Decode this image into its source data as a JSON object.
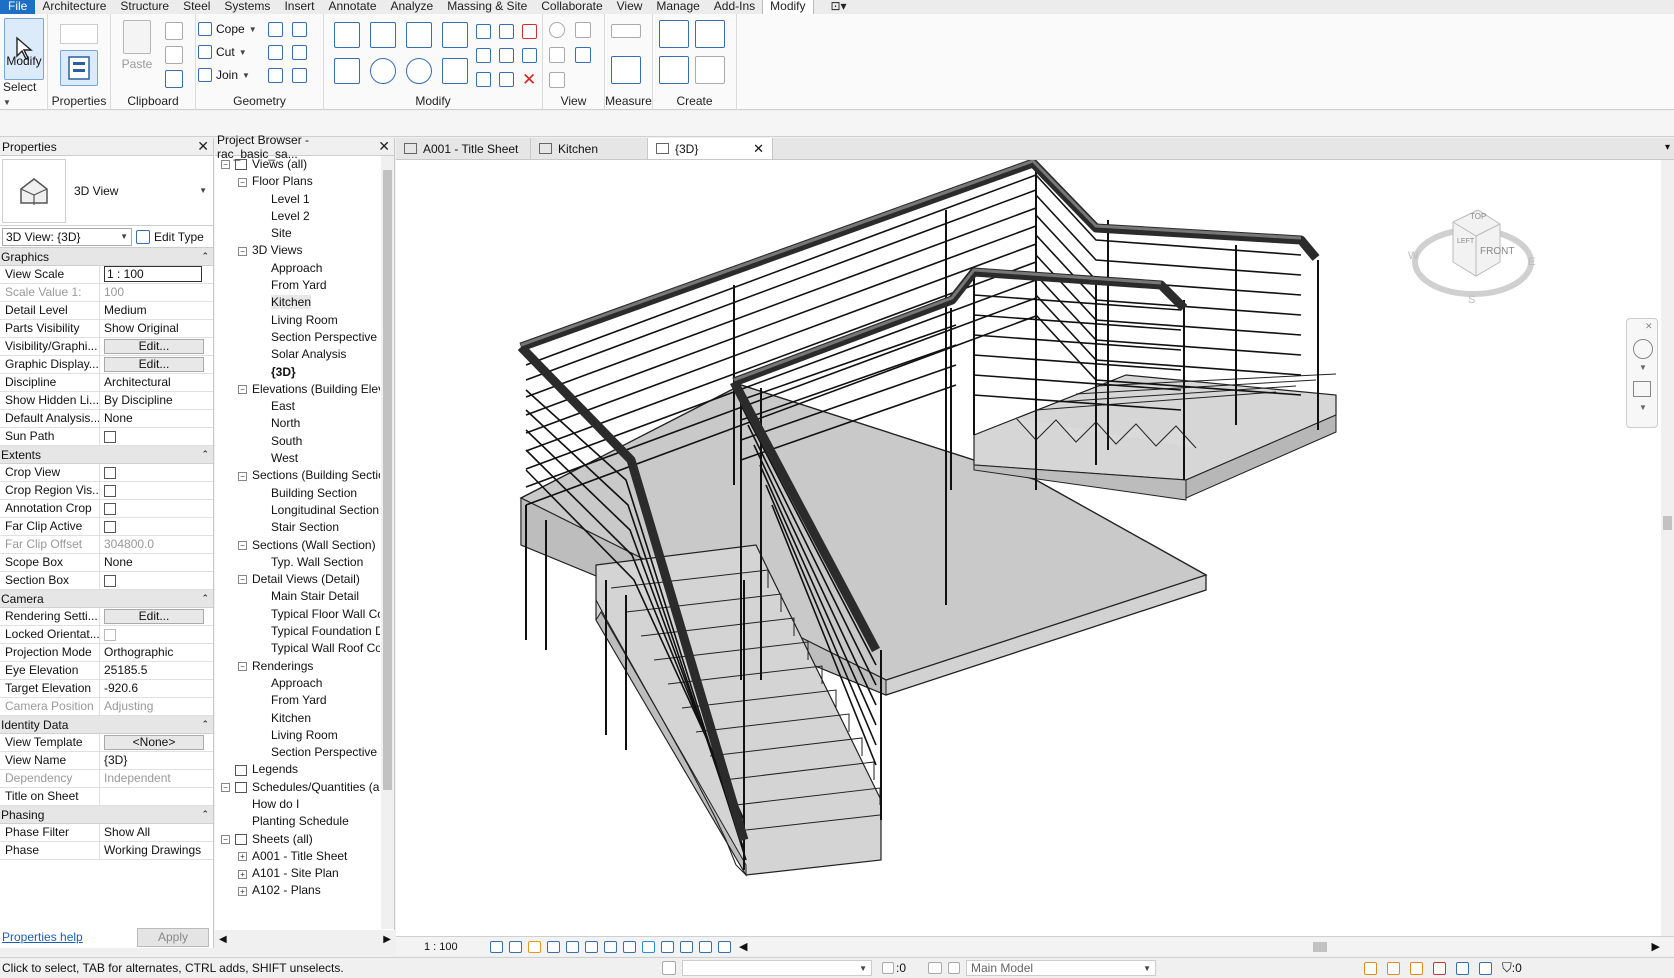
{
  "menu": {
    "file": "File",
    "tabs": [
      "Architecture",
      "Structure",
      "Steel",
      "Systems",
      "Insert",
      "Annotate",
      "Analyze",
      "Massing & Site",
      "Collaborate",
      "View",
      "Manage",
      "Add-Ins",
      "Modify"
    ],
    "active": "Modify"
  },
  "ribbon": {
    "select": {
      "modify_label": "Modify",
      "panel": "Select"
    },
    "properties": {
      "panel": "Properties"
    },
    "clipboard": {
      "paste_label": "Paste",
      "panel": "Clipboard"
    },
    "geometry": {
      "cope_label": "Cope",
      "cut_label": "Cut",
      "join_label": "Join",
      "panel": "Geometry"
    },
    "modify": {
      "panel": "Modify"
    },
    "view": {
      "panel": "View"
    },
    "measure": {
      "panel": "Measure"
    },
    "create": {
      "panel": "Create"
    }
  },
  "properties": {
    "title": "Properties",
    "type_name": "3D View",
    "view_selector": "3D View: {3D}",
    "edit_type": "Edit Type",
    "sections": [
      {
        "name": "Graphics",
        "rows": [
          {
            "k": "View Scale",
            "v": "1 : 100",
            "t": "input"
          },
          {
            "k": "Scale Value    1:",
            "v": "100",
            "t": "dis"
          },
          {
            "k": "Detail Level",
            "v": "Medium"
          },
          {
            "k": "Parts Visibility",
            "v": "Show Original"
          },
          {
            "k": "Visibility/Graphi...",
            "v": "Edit...",
            "t": "btn"
          },
          {
            "k": "Graphic Display...",
            "v": "Edit...",
            "t": "btn"
          },
          {
            "k": "Discipline",
            "v": "Architectural"
          },
          {
            "k": "Show Hidden Li...",
            "v": "By Discipline"
          },
          {
            "k": "Default Analysis...",
            "v": "None"
          },
          {
            "k": "Sun Path",
            "v": "",
            "t": "chk"
          }
        ]
      },
      {
        "name": "Extents",
        "rows": [
          {
            "k": "Crop View",
            "v": "",
            "t": "chk"
          },
          {
            "k": "Crop Region Vis...",
            "v": "",
            "t": "chk"
          },
          {
            "k": "Annotation Crop",
            "v": "",
            "t": "chk"
          },
          {
            "k": "Far Clip Active",
            "v": "",
            "t": "chk"
          },
          {
            "k": "Far Clip Offset",
            "v": "304800.0",
            "t": "dis"
          },
          {
            "k": "Scope Box",
            "v": "None"
          },
          {
            "k": "Section Box",
            "v": "",
            "t": "chk"
          }
        ]
      },
      {
        "name": "Camera",
        "rows": [
          {
            "k": "Rendering Setti...",
            "v": "Edit...",
            "t": "btn"
          },
          {
            "k": "Locked Orientat...",
            "v": "",
            "t": "chkdis"
          },
          {
            "k": "Projection Mode",
            "v": "Orthographic"
          },
          {
            "k": "Eye Elevation",
            "v": "25185.5"
          },
          {
            "k": "Target Elevation",
            "v": "-920.6"
          },
          {
            "k": "Camera Position",
            "v": "Adjusting",
            "t": "dis"
          }
        ]
      },
      {
        "name": "Identity Data",
        "rows": [
          {
            "k": "View Template",
            "v": "<None>",
            "t": "btn"
          },
          {
            "k": "View Name",
            "v": "{3D}"
          },
          {
            "k": "Dependency",
            "v": "Independent",
            "t": "dis"
          },
          {
            "k": "Title on Sheet",
            "v": ""
          }
        ]
      },
      {
        "name": "Phasing",
        "rows": [
          {
            "k": "Phase Filter",
            "v": "Show All"
          },
          {
            "k": "Phase",
            "v": "Working Drawings"
          }
        ]
      }
    ],
    "help_link": "Properties help",
    "apply": "Apply"
  },
  "browser": {
    "title": "Project Browser - rac_basic_sa...",
    "nodes": [
      {
        "l": 0,
        "t": "Views (all)",
        "tog": "-",
        "icon": true
      },
      {
        "l": 1,
        "t": "Floor Plans",
        "tog": "-"
      },
      {
        "l": 2,
        "t": "Level 1"
      },
      {
        "l": 2,
        "t": "Level 2"
      },
      {
        "l": 2,
        "t": "Site"
      },
      {
        "l": 1,
        "t": "3D Views",
        "tog": "-"
      },
      {
        "l": 2,
        "t": "Approach"
      },
      {
        "l": 2,
        "t": "From Yard"
      },
      {
        "l": 2,
        "t": "Kitchen",
        "sel": true
      },
      {
        "l": 2,
        "t": "Living Room"
      },
      {
        "l": 2,
        "t": "Section Perspective"
      },
      {
        "l": 2,
        "t": "Solar Analysis"
      },
      {
        "l": 2,
        "t": "{3D}",
        "bold": true
      },
      {
        "l": 1,
        "t": "Elevations (Building Eleva",
        "tog": "-"
      },
      {
        "l": 2,
        "t": "East"
      },
      {
        "l": 2,
        "t": "North"
      },
      {
        "l": 2,
        "t": "South"
      },
      {
        "l": 2,
        "t": "West"
      },
      {
        "l": 1,
        "t": "Sections (Building Sectio",
        "tog": "-"
      },
      {
        "l": 2,
        "t": "Building Section"
      },
      {
        "l": 2,
        "t": "Longitudinal Section"
      },
      {
        "l": 2,
        "t": "Stair Section"
      },
      {
        "l": 1,
        "t": "Sections (Wall Section)",
        "tog": "-"
      },
      {
        "l": 2,
        "t": "Typ. Wall Section"
      },
      {
        "l": 1,
        "t": "Detail Views (Detail)",
        "tog": "-"
      },
      {
        "l": 2,
        "t": "Main Stair Detail"
      },
      {
        "l": 2,
        "t": "Typical Floor Wall Co"
      },
      {
        "l": 2,
        "t": "Typical Foundation D"
      },
      {
        "l": 2,
        "t": "Typical Wall Roof Cor"
      },
      {
        "l": 1,
        "t": "Renderings",
        "tog": "-"
      },
      {
        "l": 2,
        "t": "Approach"
      },
      {
        "l": 2,
        "t": "From Yard"
      },
      {
        "l": 2,
        "t": "Kitchen"
      },
      {
        "l": 2,
        "t": "Living Room"
      },
      {
        "l": 2,
        "t": "Section Perspective"
      },
      {
        "l": 0,
        "t": "Legends",
        "icon": true
      },
      {
        "l": 0,
        "t": "Schedules/Quantities (all",
        "tog": "-",
        "icon": true
      },
      {
        "l": 1,
        "t": "How do I"
      },
      {
        "l": 1,
        "t": "Planting Schedule"
      },
      {
        "l": 0,
        "t": "Sheets (all)",
        "tog": "-",
        "icon": true
      },
      {
        "l": 1,
        "t": "A001 - Title Sheet",
        "tog": "+"
      },
      {
        "l": 1,
        "t": "A101 - Site Plan",
        "tog": "+"
      },
      {
        "l": 1,
        "t": "A102 - Plans",
        "tog": "+"
      }
    ]
  },
  "view_tabs": [
    {
      "label": "A001 - Title Sheet"
    },
    {
      "label": "Kitchen"
    },
    {
      "label": "{3D}",
      "active": true
    }
  ],
  "viewcube": {
    "top": "TOP",
    "front": "FRONT",
    "left": "LEFT",
    "w": "W",
    "s": "S",
    "e": "E"
  },
  "view_control_bar": {
    "scale": "1 : 100"
  },
  "status": {
    "message": "Click to select, TAB for alternates, CTRL adds, SHIFT unselects.",
    "count": ":0",
    "model": "Main Model",
    "filter": ":0"
  }
}
